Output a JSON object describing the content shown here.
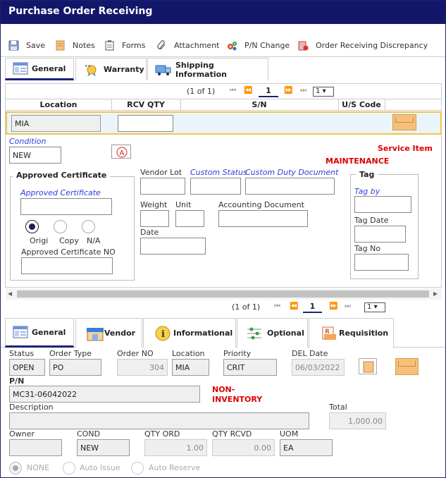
{
  "title": "Purchase Order Receiving",
  "toolbar": {
    "save": "Save",
    "notes": "Notes",
    "forms": "Forms",
    "attachment": "Attachment",
    "pn_change": "P/N Change",
    "discrepancy": "Order Receiving Discrepancy"
  },
  "top_tabs": [
    "General",
    "Warranty",
    "Shipping Information"
  ],
  "pager_top": {
    "count": "(1 of 1)",
    "page": "1",
    "select": "1"
  },
  "grid": {
    "headers": [
      "Location",
      "RCV QTY",
      "S/N",
      "U/S Code"
    ],
    "row": {
      "location": "MIA",
      "rcv_qty": ""
    }
  },
  "condition": {
    "label": "Condition",
    "value": "NEW"
  },
  "service_item": "Service Item",
  "maintenance": "MAINTENANCE",
  "approved_cert": {
    "group": "Approved Certificate",
    "link": "Approved Certificate",
    "value": "",
    "radios": [
      "Origi",
      "Copy",
      "N/A"
    ],
    "no_label": "Approved Certificate NO",
    "no_value": ""
  },
  "fields": {
    "vendor_lot": "Vendor Lot",
    "custom_status": "Custom Status",
    "custom_duty": "Custom Duty Document",
    "weight": "Weight",
    "unit": "Unit",
    "accounting_doc": "Accounting Document",
    "date": "Date"
  },
  "tag": {
    "group": "Tag",
    "tag_by": "Tag by",
    "tag_date": "Tag Date",
    "tag_no": "Tag No"
  },
  "pager_bottom": {
    "count": "(1 of 1)",
    "page": "1",
    "select": "1"
  },
  "bottom_tabs": [
    "General",
    "Vendor",
    "Informational",
    "Optional",
    "Requisition"
  ],
  "order": {
    "status_label": "Status",
    "status": "OPEN",
    "order_type_label": "Order Type",
    "order_type": "PO",
    "order_no_label": "Order NO",
    "order_no": "304",
    "location_label": "Location",
    "location": "MIA",
    "priority_label": "Priority",
    "priority": "CRIT",
    "del_date_label": "DEL Date",
    "del_date": "06/03/2022",
    "pn_label": "P/N",
    "pn": "MC31-06042022",
    "non_inventory": "NON-\nINVENTORY",
    "description_label": "Description",
    "description": "",
    "total_label": "Total",
    "total": "1,000.00",
    "owner_label": "Owner",
    "owner": "",
    "cond_label": "COND",
    "cond": "NEW",
    "qty_ord_label": "QTY ORD",
    "qty_ord": "1.00",
    "qty_rcvd_label": "QTY RCVD",
    "qty_rcvd": "0.00",
    "uom_label": "UOM",
    "uom": "EA"
  },
  "issue_options": [
    "NONE",
    "Auto Issue",
    "Auto Reserve"
  ]
}
